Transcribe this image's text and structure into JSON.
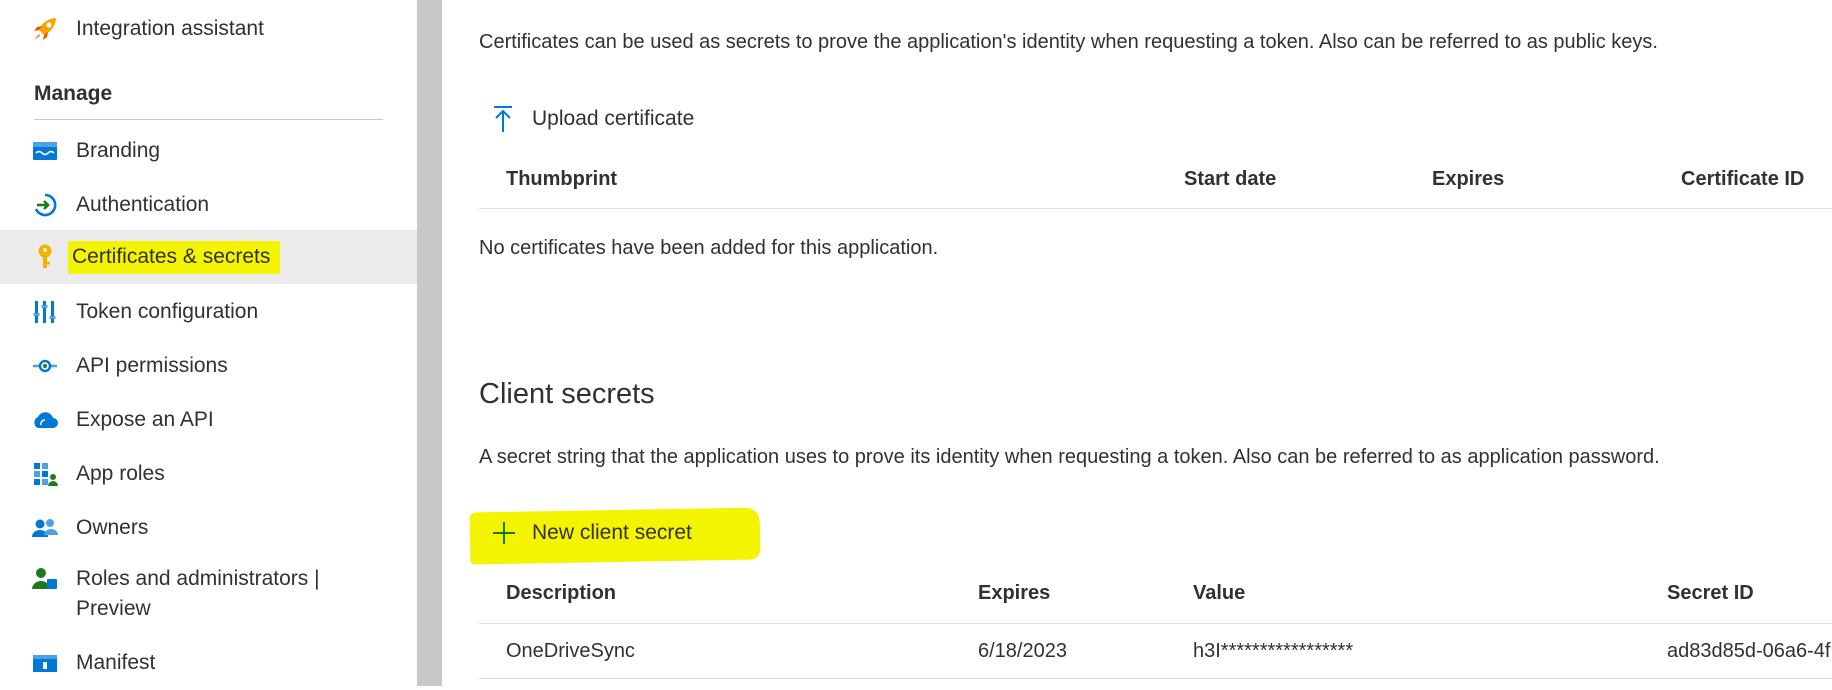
{
  "sidebar": {
    "top_item": {
      "label": "Integration assistant",
      "icon": "rocket-icon"
    },
    "manage_header": "Manage",
    "items": [
      {
        "label": "Branding",
        "icon": "branding-icon"
      },
      {
        "label": "Authentication",
        "icon": "authentication-icon"
      },
      {
        "label": "Certificates & secrets",
        "icon": "key-icon",
        "selected": true
      },
      {
        "label": "Token configuration",
        "icon": "token-icon"
      },
      {
        "label": "API permissions",
        "icon": "api-permissions-icon"
      },
      {
        "label": "Expose an API",
        "icon": "cloud-icon"
      },
      {
        "label": "App roles",
        "icon": "app-roles-icon"
      },
      {
        "label": "Owners",
        "icon": "owners-icon"
      },
      {
        "label": "Roles and administrators |",
        "label_line2": "Preview",
        "icon": "roles-admin-icon"
      },
      {
        "label": "Manifest",
        "icon": "manifest-icon"
      }
    ]
  },
  "certificates": {
    "description": "Certificates can be used as secrets to prove the application's identity when requesting a token. Also can be referred to as public keys.",
    "upload_label": "Upload certificate",
    "columns": [
      "Thumbprint",
      "Start date",
      "Expires",
      "Certificate ID"
    ],
    "empty_message": "No certificates have been added for this application."
  },
  "client_secrets": {
    "title": "Client secrets",
    "description": "A secret string that the application uses to prove its identity when requesting a token. Also can be referred to as application password.",
    "new_label": "New client secret",
    "columns": [
      "Description",
      "Expires",
      "Value",
      "Secret ID"
    ],
    "rows": [
      {
        "description": "OneDriveSync",
        "expires": "6/18/2023",
        "value": "h3I*****************",
        "secret_id": "ad83d85d-06a6-4f"
      }
    ]
  },
  "colors": {
    "highlight": "#f4f400",
    "accent_blue": "#0078d4",
    "add_green": "#107c10",
    "selected_bg": "#ebebeb"
  }
}
